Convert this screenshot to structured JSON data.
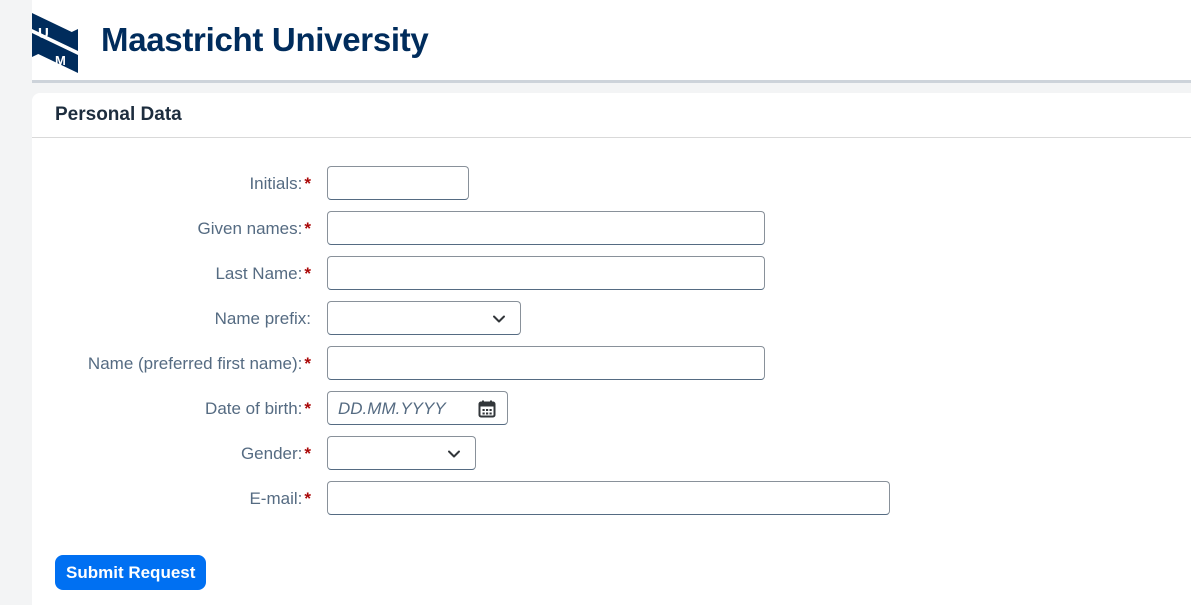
{
  "header": {
    "logo_icon": "um-logo-icon",
    "logo_letters": [
      "U",
      "M"
    ],
    "brand": "Maastricht University"
  },
  "panel": {
    "title": "Personal Data"
  },
  "form": {
    "required_marker": "*",
    "fields": {
      "initials": {
        "label": "Initials:",
        "value": ""
      },
      "given_names": {
        "label": "Given names:",
        "value": ""
      },
      "last_name": {
        "label": "Last Name:",
        "value": ""
      },
      "name_prefix": {
        "label": "Name prefix:",
        "selected": ""
      },
      "preferred_name": {
        "label": "Name (preferred first name):",
        "value": ""
      },
      "date_of_birth": {
        "label": "Date of birth:",
        "placeholder": "DD.MM.YYYY",
        "icon": "calendar-icon"
      },
      "gender": {
        "label": "Gender:",
        "selected": ""
      },
      "email": {
        "label": "E-mail:",
        "value": ""
      }
    },
    "submit_label": "Submit Request"
  },
  "colors": {
    "brand": "#002c5c",
    "accent": "#0070f2",
    "required": "#aa0808",
    "label": "#556b82"
  }
}
